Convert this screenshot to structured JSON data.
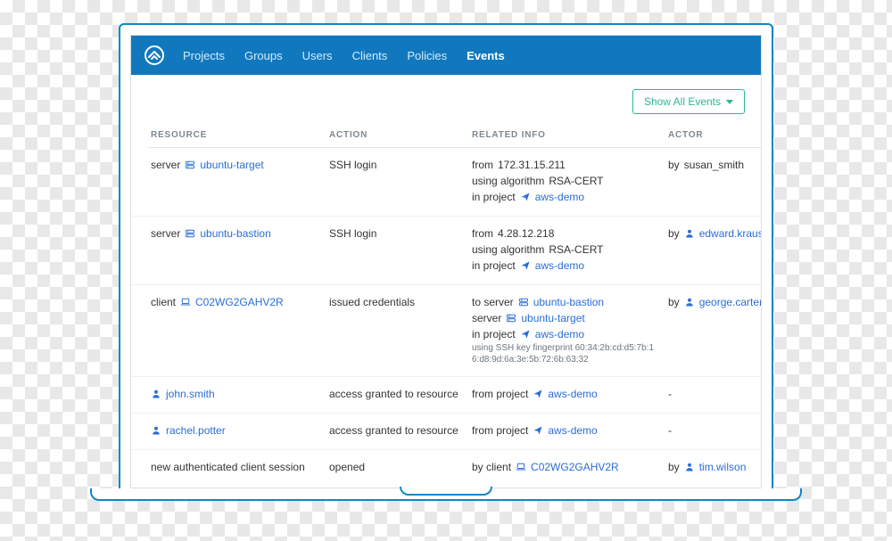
{
  "nav": {
    "items": [
      "Projects",
      "Groups",
      "Users",
      "Clients",
      "Policies",
      "Events"
    ],
    "active": "Events"
  },
  "toolbar": {
    "show_all_label": "Show All Events"
  },
  "columns": {
    "resource": "RESOURCE",
    "action": "ACTION",
    "related": "RELATED INFO",
    "actor": "ACTOR"
  },
  "labels": {
    "server": "server",
    "client": "client",
    "from": "from",
    "to_server": "to server",
    "using_algo": "using algorithm",
    "in_project": "in project",
    "from_project": "from project",
    "by": "by",
    "by_client": "by client",
    "dash": "-"
  },
  "rows": [
    {
      "resource_type": "server",
      "resource_icon": "server",
      "resource_value": "ubuntu-target",
      "action": "SSH login",
      "related": [
        {
          "kind": "from_ip",
          "value": "172.31.15.211"
        },
        {
          "kind": "algo",
          "value": "RSA-CERT"
        },
        {
          "kind": "project",
          "value": "aws-demo"
        }
      ],
      "actor_prefix": "by",
      "actor_value": "susan_smith",
      "actor_link": false,
      "actor_icon": null
    },
    {
      "resource_type": "server",
      "resource_icon": "server",
      "resource_value": "ubuntu-bastion",
      "action": "SSH login",
      "related": [
        {
          "kind": "from_ip",
          "value": "4.28.12.218"
        },
        {
          "kind": "algo",
          "value": "RSA-CERT"
        },
        {
          "kind": "project",
          "value": "aws-demo"
        }
      ],
      "actor_prefix": "by",
      "actor_value": "edward.krause",
      "actor_link": true,
      "actor_icon": "user"
    },
    {
      "resource_type": "client",
      "resource_icon": "laptop",
      "resource_value": "C02WG2GAHV2R",
      "action": "issued credentials",
      "related": [
        {
          "kind": "to_server",
          "value": "ubuntu-bastion"
        },
        {
          "kind": "server",
          "value": "ubuntu-target"
        },
        {
          "kind": "project",
          "value": "aws-demo"
        },
        {
          "kind": "fingerprint",
          "label": "using SSH key fingerprint",
          "value": "60:34:2b:cd:d5:7b:16:d8:9d:6a:3e:5b:72:6b:63:32"
        }
      ],
      "actor_prefix": "by",
      "actor_value": "george.carter",
      "actor_link": true,
      "actor_icon": "user"
    },
    {
      "resource_type": "user",
      "resource_icon": "user",
      "resource_value": "john.smith",
      "action": "access granted to resource",
      "related": [
        {
          "kind": "from_project",
          "value": "aws-demo"
        }
      ],
      "actor_prefix": null,
      "actor_value": "-",
      "actor_link": false,
      "actor_icon": null
    },
    {
      "resource_type": "user",
      "resource_icon": "user",
      "resource_value": "rachel.potter",
      "action": "access granted to resource",
      "related": [
        {
          "kind": "from_project",
          "value": "aws-demo"
        }
      ],
      "actor_prefix": null,
      "actor_value": "-",
      "actor_link": false,
      "actor_icon": null
    },
    {
      "resource_type": "text",
      "resource_icon": null,
      "resource_value": "new authenticated client session",
      "action": "opened",
      "related": [
        {
          "kind": "by_client",
          "value": "C02WG2GAHV2R"
        }
      ],
      "actor_prefix": "by",
      "actor_value": "tim.wilson",
      "actor_link": true,
      "actor_icon": "user"
    }
  ],
  "colors": {
    "nav_bg": "#1178bd",
    "link": "#2a6dd6",
    "accent": "#2bb596"
  }
}
